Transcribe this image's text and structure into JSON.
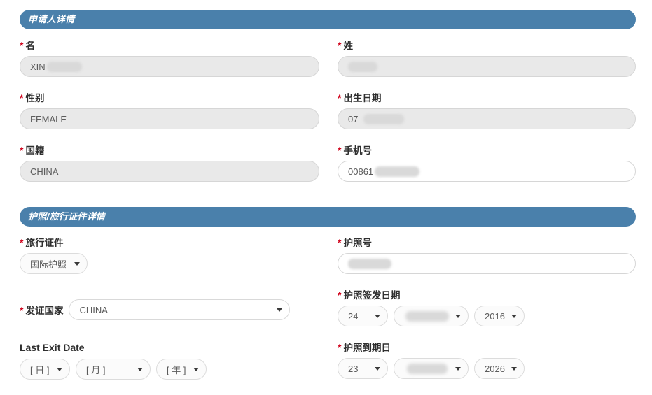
{
  "theme": {
    "bar_color": "#4a80ab",
    "required_color": "#d0021b",
    "readonly_field_bg": "#e9e9e9",
    "editable_field_bg": "#ffffff",
    "text_color": "#5b5b5b"
  },
  "sections": [
    {
      "id": "applicant-details",
      "title": "申请人详情"
    },
    {
      "id": "passport-details",
      "title": "护照/旅行证件详情"
    }
  ],
  "fields": {
    "given_name": {
      "label": "名",
      "required_mark": "*",
      "value": "XIN",
      "redacted": true,
      "readonly": true
    },
    "surname": {
      "label": "姓",
      "required_mark": "*",
      "value": "",
      "redacted": true,
      "readonly": true
    },
    "gender": {
      "label": "性别",
      "required_mark": "*",
      "value": "FEMALE",
      "redacted": false,
      "readonly": true
    },
    "date_of_birth": {
      "label": "出生日期",
      "required_mark": "*",
      "value": "07",
      "redacted": true,
      "readonly": true
    },
    "nationality": {
      "label": "国籍",
      "required_mark": "*",
      "value": "CHINA",
      "redacted": false,
      "readonly": true
    },
    "mobile_number": {
      "label": "手机号",
      "required_mark": "*",
      "value": "00861",
      "redacted": true,
      "readonly": false
    },
    "travel_document": {
      "label": "旅行证件",
      "required_mark": "*",
      "value": "国际护照"
    },
    "passport_number": {
      "label": "护照号",
      "required_mark": "*",
      "value": "",
      "redacted": true,
      "readonly": false
    },
    "issuing_country": {
      "label": "发证国家",
      "required_mark": "*",
      "value": "CHINA"
    },
    "passport_issue_date": {
      "label": "护照签发日期",
      "required_mark": "*",
      "day": "24",
      "month": "",
      "month_redacted": true,
      "year": "2016"
    },
    "last_exit_date": {
      "label": "Last Exit Date",
      "required_mark": "",
      "day": "[ 日 ]",
      "month": "[ 月 ]",
      "year": "[ 年 ]"
    },
    "passport_expiry_date": {
      "label": "护照到期日",
      "required_mark": "*",
      "day": "23",
      "month": "",
      "month_redacted": true,
      "year": "2026"
    }
  }
}
